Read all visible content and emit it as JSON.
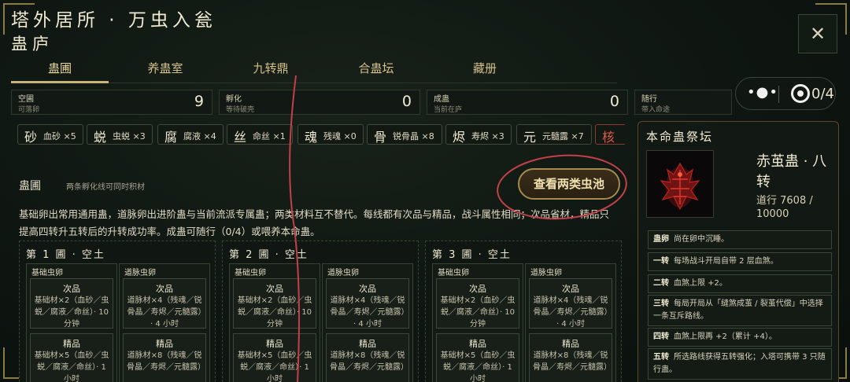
{
  "header": {
    "title": "塔外居所 · 万虫入瓮",
    "subtitle": "蛊庐",
    "close_label": "✕"
  },
  "tabs": [
    {
      "label": "蛊圃"
    },
    {
      "label": "养蛊室"
    },
    {
      "label": "九转鼎"
    },
    {
      "label": "合蛊坛"
    },
    {
      "label": "藏册"
    }
  ],
  "capsule": {
    "count": "0/4"
  },
  "stats": [
    {
      "label": "空圃",
      "sub": "可落卵",
      "value": "9"
    },
    {
      "label": "孵化",
      "sub": "等待破壳",
      "value": "0"
    },
    {
      "label": "成蛊",
      "sub": "当前在庐",
      "value": "0"
    },
    {
      "label": "随行",
      "sub": "带入命途",
      "value": ""
    }
  ],
  "materials": [
    {
      "char": "砂",
      "name": "血砂",
      "count": "×5"
    },
    {
      "char": "蜕",
      "name": "虫蜕",
      "count": "×3"
    },
    {
      "char": "腐",
      "name": "腐液",
      "count": "×4"
    },
    {
      "char": "丝",
      "name": "命丝",
      "count": "×1"
    },
    {
      "char": "魂",
      "name": "残魂",
      "count": "×0"
    },
    {
      "char": "骨",
      "name": "锐骨晶",
      "count": "×8"
    },
    {
      "char": "烬",
      "name": "寿烬",
      "count": "×3"
    },
    {
      "char": "元",
      "name": "元髓露",
      "count": "×7"
    },
    {
      "char": "核",
      "name": "",
      "count": ""
    }
  ],
  "section": {
    "title": "蛊圃",
    "note": "两条孵化线可同时积材",
    "button": "查看两类虫池",
    "desc": "基础卵出常用通用蛊，道脉卵出进阶蛊与当前流派专属蛊；两类材料互不替代。每线都有次品与精品，战斗属性相同；次品省材，精品只提高四转升五转后的升转成功率。成蛊可随行（0/4）或喂养本命蛊。"
  },
  "slots": [
    {
      "title": "第 1 圃 · 空土",
      "basic": {
        "head": "基础虫卵",
        "low_t": "次品",
        "low_d": "基础材×2（血砂／虫蜕／腐液／命丝）· 10 分钟",
        "high_t": "精品",
        "high_d": "基础材×5（血砂／虫蜕／腐液／命丝）· 1 小时"
      },
      "dao": {
        "head": "道脉虫卵",
        "low_t": "次品",
        "low_d": "道脉材×4（残魂／锐骨晶／寿烬／元髓露）· 4 小时",
        "high_t": "精品",
        "high_d": "道脉材×8（残魂／锐骨晶／寿烬／元髓露）"
      }
    },
    {
      "title": "第 2 圃 · 空土",
      "basic": {
        "head": "基础虫卵",
        "low_t": "次品",
        "low_d": "基础材×2（血砂／虫蜕／腐液／命丝）· 10 分钟",
        "high_t": "精品",
        "high_d": "基础材×5（血砂／虫蜕／腐液／命丝）· 1 小时"
      },
      "dao": {
        "head": "道脉虫卵",
        "low_t": "次品",
        "low_d": "道脉材×4（残魂／锐骨晶／寿烬／元髓露）· 4 小时",
        "high_t": "精品",
        "high_d": "道脉材×8（残魂／锐骨晶／寿烬／元髓露）"
      }
    },
    {
      "title": "第 3 圃 · 空土",
      "basic": {
        "head": "基础虫卵",
        "low_t": "次品",
        "low_d": "基础材×2（血砂／虫蜕／腐液／命丝）· 10 分钟",
        "high_t": "精品",
        "high_d": "基础材×5（血砂／虫蜕／腐液／命丝）· 1 小时"
      },
      "dao": {
        "head": "道脉虫卵",
        "low_t": "次品",
        "low_d": "道脉材×4（残魂／锐骨晶／寿烬／元髓露）· 4 小时",
        "high_t": "精品",
        "high_d": "道脉材×8（残魂／锐骨晶／寿烬／元髓露）"
      }
    }
  ],
  "altar": {
    "title": "本命蛊祭坛",
    "name": "赤茧蛊 · 八转",
    "path": "道行 7608 / 10000",
    "stages": [
      {
        "tier": "蛊卵",
        "text": "尚在卵中沉睡。"
      },
      {
        "tier": "一转",
        "text": "每场战斗开局自带 2 层血煞。"
      },
      {
        "tier": "二转",
        "text": "血煞上限 +2。"
      },
      {
        "tier": "三转",
        "text": "每局开局从「缝煞成茧 / 裂茧代偿」中选择一条互斥路线。"
      },
      {
        "tier": "四转",
        "text": "血煞上限再 +2（累计 +4）。"
      },
      {
        "tier": "五转",
        "text": "所选路线获得五转强化；入塔可携带 3 只随行蛊。"
      }
    ]
  }
}
